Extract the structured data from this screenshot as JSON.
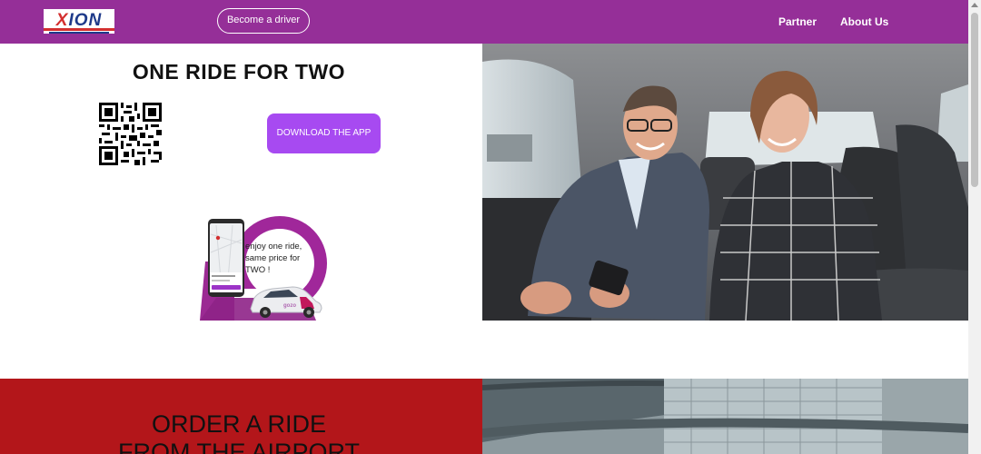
{
  "header": {
    "logo_text": "XION",
    "become_driver": "Become a driver",
    "nav": [
      "Partner",
      "About Us"
    ]
  },
  "hero": {
    "title": "ONE RIDE FOR TWO",
    "download_button": "DOWNLOAD THE APP",
    "promo_text": "enjoy one ride, same price for TWO !"
  },
  "airport": {
    "title_line1": "ORDER A RIDE",
    "title_line2": "FROM THE AIRPORT"
  },
  "colors": {
    "header_bg": "#952f98",
    "button_bg": "#a74af1",
    "red_panel": "#b3161a"
  }
}
